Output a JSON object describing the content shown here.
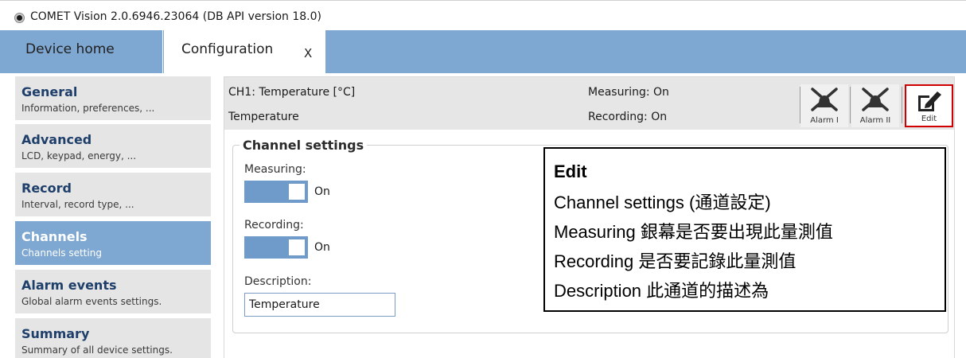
{
  "window": {
    "title": "COMET Vision 2.0.6946.23064 (DB API version 18.0)"
  },
  "tabs": {
    "home": "Device home",
    "config": "Configuration",
    "close": "X"
  },
  "sidebar": {
    "items": [
      {
        "title": "General",
        "subtitle": "Information, preferences, ..."
      },
      {
        "title": "Advanced",
        "subtitle": "LCD, keypad, energy, ..."
      },
      {
        "title": "Record",
        "subtitle": "Interval, record type, ..."
      },
      {
        "title": "Channels",
        "subtitle": "Channels setting"
      },
      {
        "title": "Alarm events",
        "subtitle": "Global alarm events settings."
      },
      {
        "title": "Summary",
        "subtitle": "Summary of all device settings."
      }
    ]
  },
  "channel": {
    "name": "CH1:  Temperature  [°C]",
    "description": "Temperature",
    "measuring_status": "Measuring: On",
    "recording_status": "Recording: On"
  },
  "toolbar": {
    "alarm1": "Alarm I",
    "alarm2": "Alarm II",
    "edit": "Edit"
  },
  "settings": {
    "legend": "Channel settings",
    "measuring_label": "Measuring:",
    "measuring_value": "On",
    "recording_label": "Recording:",
    "recording_value": "On",
    "description_label": "Description:",
    "description_value": "Temperature"
  },
  "callout": {
    "title": "Edit",
    "lines": [
      "Channel settings (通道設定)",
      "Measuring 銀幕是否要出現此量測值",
      "Recording 是否要記錄此量測值",
      "Description 此通道的描述為"
    ]
  },
  "colors": {
    "accent": "#7ea7d1",
    "toggle": "#6f9bcb",
    "highlight": "#d00000"
  }
}
